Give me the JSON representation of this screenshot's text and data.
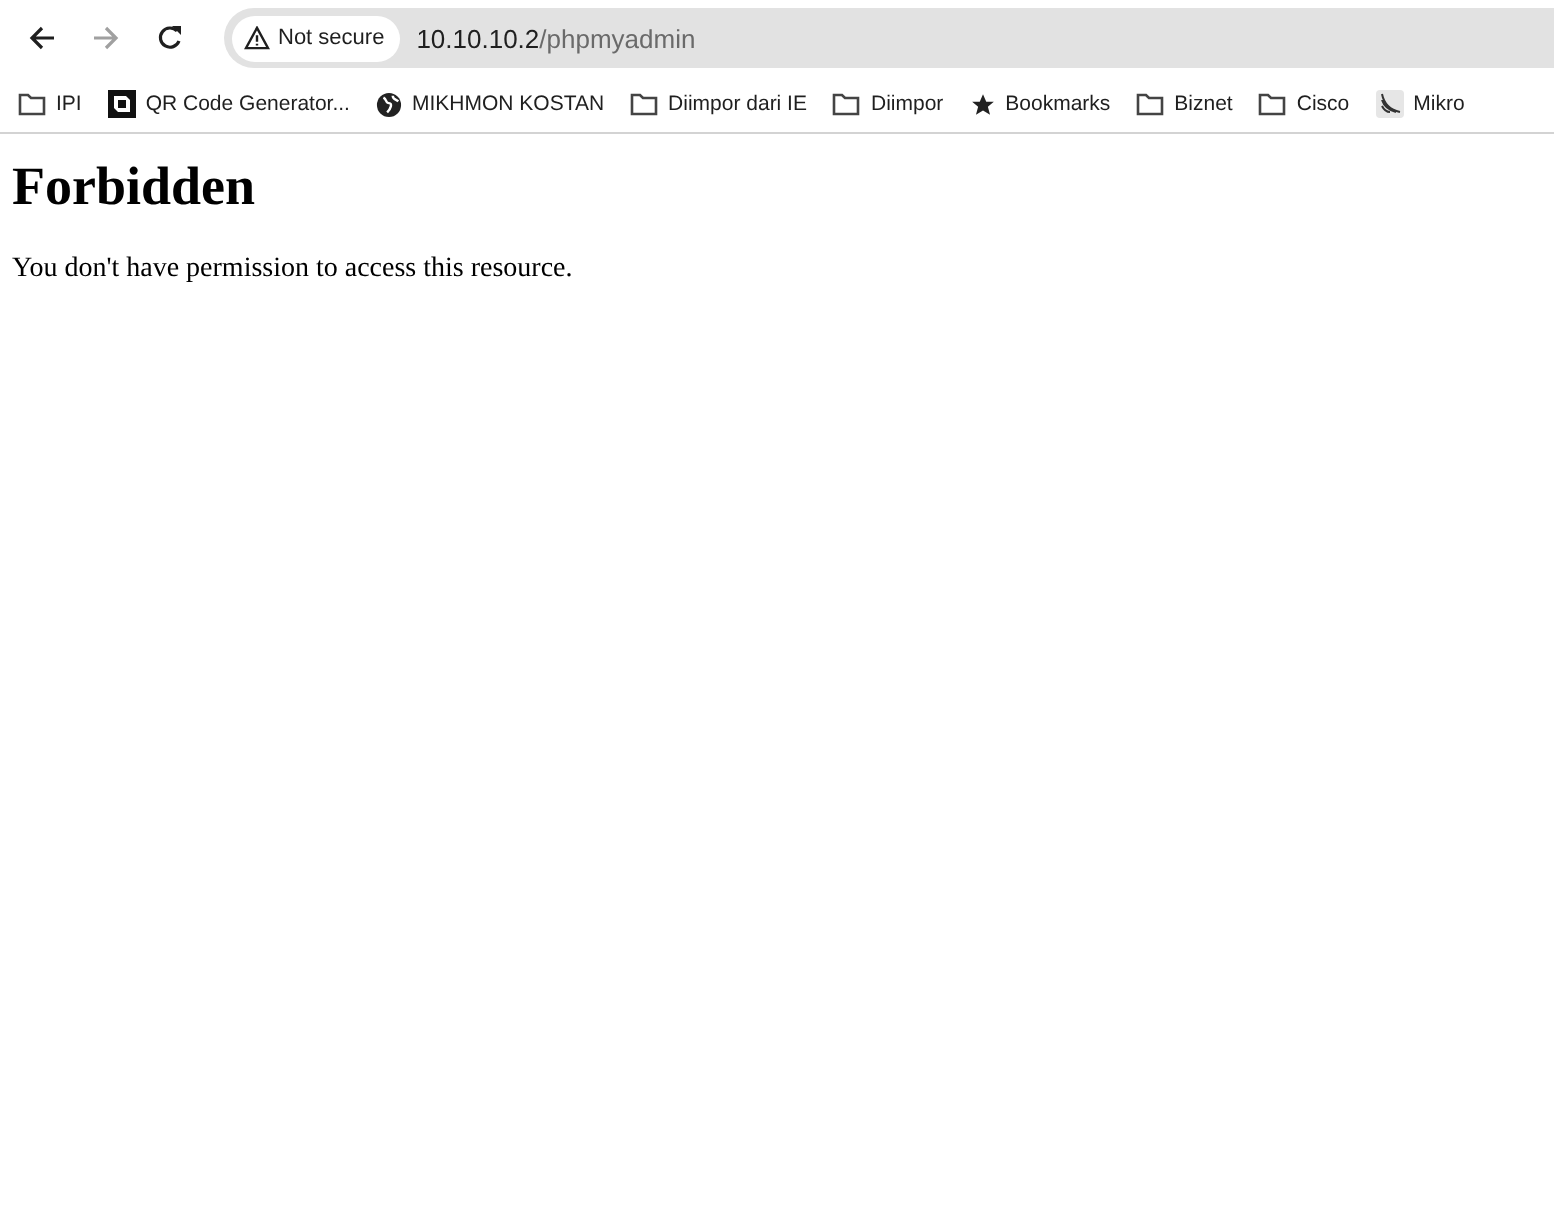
{
  "toolbar": {
    "back": {
      "disabled": false
    },
    "forward": {
      "disabled": true
    },
    "security_chip": "Not secure",
    "address": {
      "host": "10.10.10.2",
      "path": "/phpmyadmin"
    }
  },
  "bookmarks": [
    {
      "kind": "folder",
      "label": "IPI"
    },
    {
      "kind": "qr",
      "label": "QR Code Generator..."
    },
    {
      "kind": "globe",
      "label": "MIKHMON KOSTAN"
    },
    {
      "kind": "folder",
      "label": "Diimpor dari IE"
    },
    {
      "kind": "folder",
      "label": "Diimpor"
    },
    {
      "kind": "star",
      "label": "Bookmarks"
    },
    {
      "kind": "folder",
      "label": "Biznet"
    },
    {
      "kind": "folder",
      "label": "Cisco"
    },
    {
      "kind": "mikrotik",
      "label": "Mikro"
    }
  ],
  "page": {
    "heading": "Forbidden",
    "message": "You don't have permission to access this resource."
  }
}
